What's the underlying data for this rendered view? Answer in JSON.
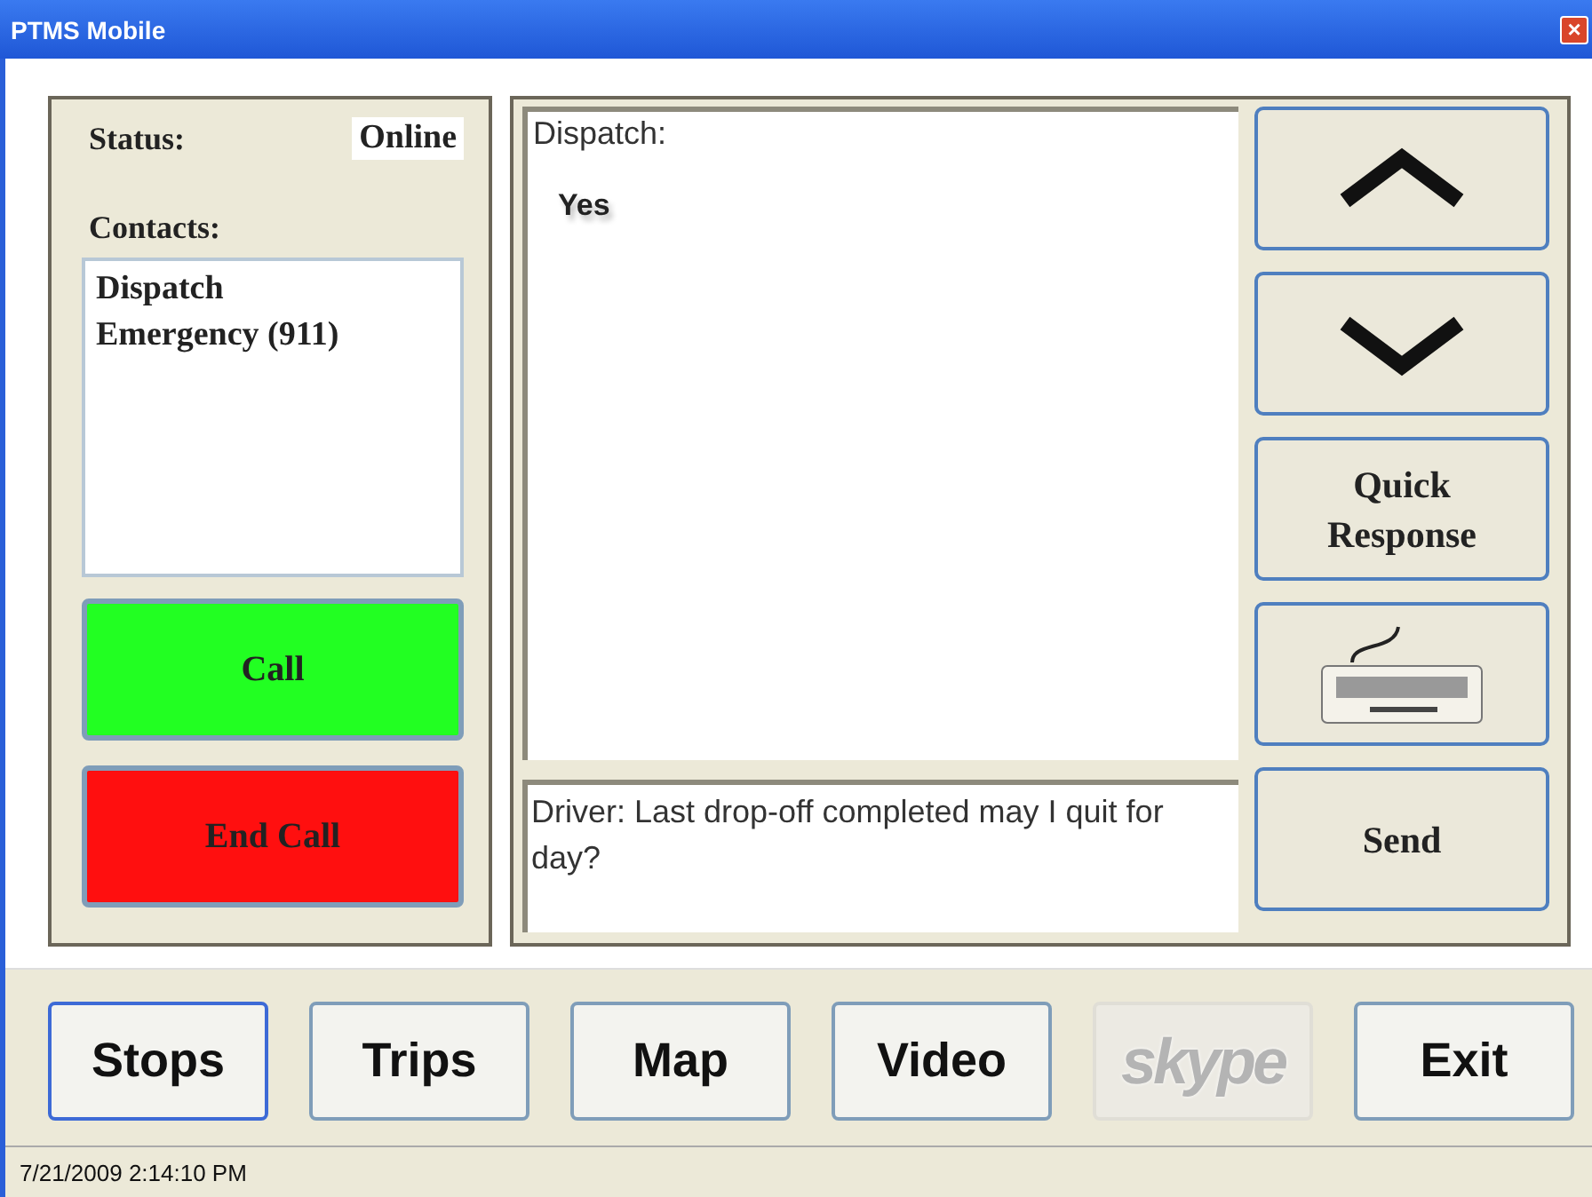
{
  "window": {
    "title": "PTMS Mobile",
    "close": "×"
  },
  "status": {
    "label": "Status:",
    "value": "Online"
  },
  "contacts": {
    "label": "Contacts:",
    "items": [
      {
        "name": "Dispatch"
      },
      {
        "name": "Emergency (911)"
      }
    ]
  },
  "call_buttons": [
    {
      "label": "Call",
      "kind": "call"
    },
    {
      "label": "End Call",
      "kind": "end"
    }
  ],
  "chat": {
    "sender": "Dispatch:",
    "message": "Yes"
  },
  "input": {
    "value": "Driver: Last drop-off completed may I quit for day?"
  },
  "side_buttons": [
    {
      "kind": "up"
    },
    {
      "kind": "down"
    },
    {
      "kind": "text",
      "label": "Quick Response"
    },
    {
      "kind": "keyboard"
    },
    {
      "kind": "text",
      "label": "Send"
    }
  ],
  "nav": [
    {
      "label": "Stops",
      "selected": true,
      "disabled": false
    },
    {
      "label": "Trips",
      "selected": false,
      "disabled": false
    },
    {
      "label": "Map",
      "selected": false,
      "disabled": false
    },
    {
      "label": "Video",
      "selected": false,
      "disabled": false
    },
    {
      "label": "skype",
      "selected": false,
      "disabled": true
    },
    {
      "label": "Exit",
      "selected": false,
      "disabled": false
    }
  ],
  "status_bar": {
    "text": "7/21/2009 2:14:10 PM"
  }
}
